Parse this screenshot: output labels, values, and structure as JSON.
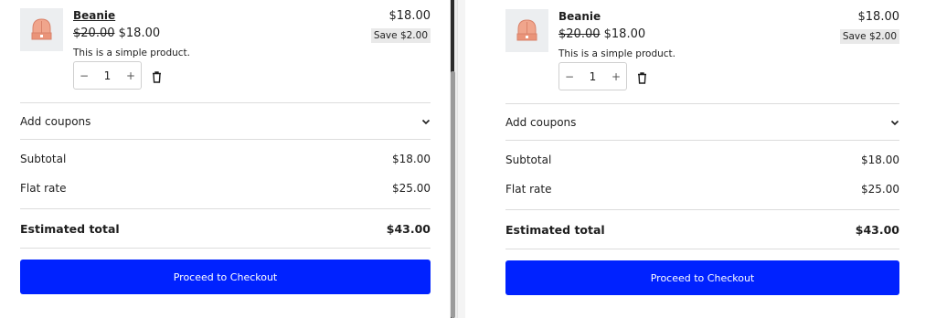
{
  "left": {
    "product": {
      "name": "Beanie",
      "old_price": "$20.00",
      "new_price": "$18.00",
      "description": "This is a simple product.",
      "quantity": "1",
      "line_price": "$18.00",
      "save_badge": "Save $2.00",
      "minus": "−",
      "plus": "+"
    },
    "coupons_label": "Add coupons",
    "subtotal_label": "Subtotal",
    "subtotal_value": "$18.00",
    "shipping_label": "Flat rate",
    "shipping_value": "$25.00",
    "total_label": "Estimated total",
    "total_value": "$43.00",
    "checkout_label": "Proceed to Checkout"
  },
  "right": {
    "product": {
      "name": "Beanie",
      "old_price": "$20.00",
      "new_price": "$18.00",
      "description": "This is a simple product.",
      "quantity": "1",
      "line_price": "$18.00",
      "save_badge": "Save $2.00",
      "minus": "−",
      "plus": "+"
    },
    "coupons_label": "Add coupons",
    "subtotal_label": "Subtotal",
    "subtotal_value": "$18.00",
    "shipping_label": "Flat rate",
    "shipping_value": "$25.00",
    "total_label": "Estimated total",
    "total_value": "$43.00",
    "checkout_label": "Proceed to Checkout"
  },
  "colors": {
    "checkout_button": "#0022ff",
    "beanie": "#f0a58c"
  },
  "icons": [
    "beanie-thumbnail",
    "trash-icon",
    "chevron-down-icon"
  ]
}
